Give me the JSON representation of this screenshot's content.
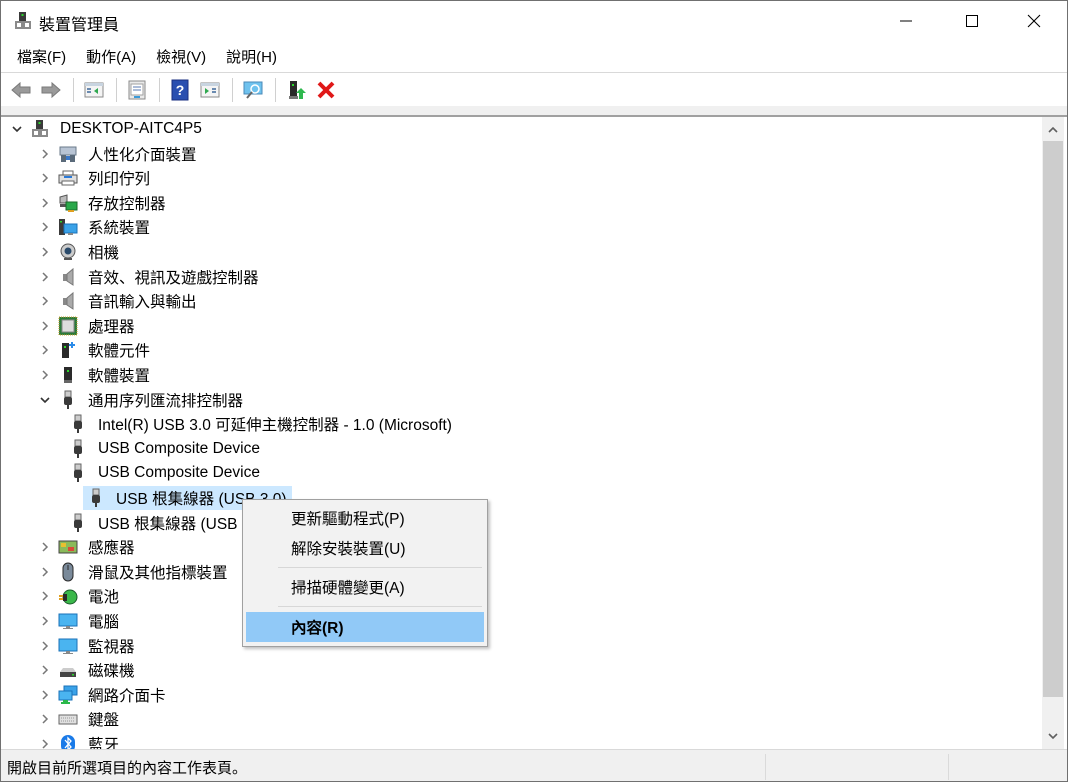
{
  "window": {
    "title": "裝置管理員",
    "icon": "device-manager-icon",
    "controls": {
      "minimize": "minimize-icon",
      "maximize": "maximize-icon",
      "close": "close-icon"
    }
  },
  "menubar": {
    "items": [
      {
        "label": "檔案(F)"
      },
      {
        "label": "動作(A)"
      },
      {
        "label": "檢視(V)"
      },
      {
        "label": "說明(H)"
      }
    ]
  },
  "toolbar": {
    "buttons": [
      {
        "name": "back",
        "icon": "arrow-left-icon"
      },
      {
        "name": "forward",
        "icon": "arrow-right-icon"
      },
      {
        "name": "show-hide-console-tree",
        "icon": "console-tree-icon"
      },
      {
        "name": "properties",
        "icon": "properties-sheet-icon"
      },
      {
        "name": "help",
        "icon": "help-icon"
      },
      {
        "name": "show-hide-action-pane",
        "icon": "action-pane-icon"
      },
      {
        "name": "scan-hardware",
        "icon": "monitor-scan-icon"
      },
      {
        "name": "update-driver",
        "icon": "update-driver-icon"
      },
      {
        "name": "uninstall-device",
        "icon": "red-x-icon"
      }
    ]
  },
  "tree": {
    "root": {
      "label": "DESKTOP-AITC4P5",
      "expanded": true,
      "icon": "computer-tower-icon"
    },
    "categories": [
      {
        "label": "人性化介面裝置",
        "icon": "hid-icon",
        "expanded": false
      },
      {
        "label": "列印佇列",
        "icon": "printer-icon",
        "expanded": false
      },
      {
        "label": "存放控制器",
        "icon": "storage-controller-icon",
        "expanded": false
      },
      {
        "label": "系統裝置",
        "icon": "system-device-icon",
        "expanded": false
      },
      {
        "label": "相機",
        "icon": "webcam-icon",
        "expanded": false
      },
      {
        "label": "音效、視訊及遊戲控制器",
        "icon": "speaker-icon",
        "expanded": false
      },
      {
        "label": "音訊輸入與輸出",
        "icon": "speaker-icon",
        "expanded": false
      },
      {
        "label": "處理器",
        "icon": "processor-icon",
        "expanded": false
      },
      {
        "label": "軟體元件",
        "icon": "software-component-icon",
        "expanded": false
      },
      {
        "label": "軟體裝置",
        "icon": "software-device-icon",
        "expanded": false
      },
      {
        "label": "通用序列匯流排控制器",
        "icon": "usb-plug-icon",
        "expanded": true,
        "children": [
          {
            "label": "Intel(R) USB 3.0 可延伸主機控制器 - 1.0 (Microsoft)",
            "icon": "usb-plug-icon",
            "selected": false
          },
          {
            "label": "USB Composite Device",
            "icon": "usb-plug-icon",
            "selected": false
          },
          {
            "label": "USB Composite Device",
            "icon": "usb-plug-icon",
            "selected": false
          },
          {
            "label": "USB 根集線器 (USB 3.0)",
            "icon": "usb-plug-icon",
            "selected": true
          },
          {
            "label": "USB 根集線器 (USB 3.0)",
            "icon": "usb-plug-icon",
            "selected": false
          }
        ]
      },
      {
        "label": "感應器",
        "icon": "sensor-icon",
        "expanded": false
      },
      {
        "label": "滑鼠及其他指標裝置",
        "icon": "mouse-icon",
        "expanded": false
      },
      {
        "label": "電池",
        "icon": "battery-icon",
        "expanded": false
      },
      {
        "label": "電腦",
        "icon": "monitor-icon",
        "expanded": false
      },
      {
        "label": "監視器",
        "icon": "monitor-icon",
        "expanded": false
      },
      {
        "label": "磁碟機",
        "icon": "disk-drive-icon",
        "expanded": false
      },
      {
        "label": "網路介面卡",
        "icon": "network-adapter-icon",
        "expanded": false
      },
      {
        "label": "鍵盤",
        "icon": "keyboard-icon",
        "expanded": false
      },
      {
        "label": "藍牙",
        "icon": "bluetooth-icon",
        "expanded": false
      }
    ]
  },
  "context_menu": {
    "items": [
      {
        "label": "更新驅動程式(P)",
        "highlighted": false
      },
      {
        "label": "解除安裝裝置(U)",
        "highlighted": false
      },
      {
        "separator": true
      },
      {
        "label": "掃描硬體變更(A)",
        "highlighted": false
      },
      {
        "separator": true
      },
      {
        "label": "內容(R)",
        "highlighted": true,
        "bold": true
      }
    ]
  },
  "statusbar": {
    "text": "開啟目前所選項目的內容工作表頁。"
  },
  "colors": {
    "selection": "#cce8ff",
    "menu_highlight": "#91c9f7",
    "scroll_thumb": "#cdcdcd",
    "chrome_bg": "#f0f0f0"
  }
}
